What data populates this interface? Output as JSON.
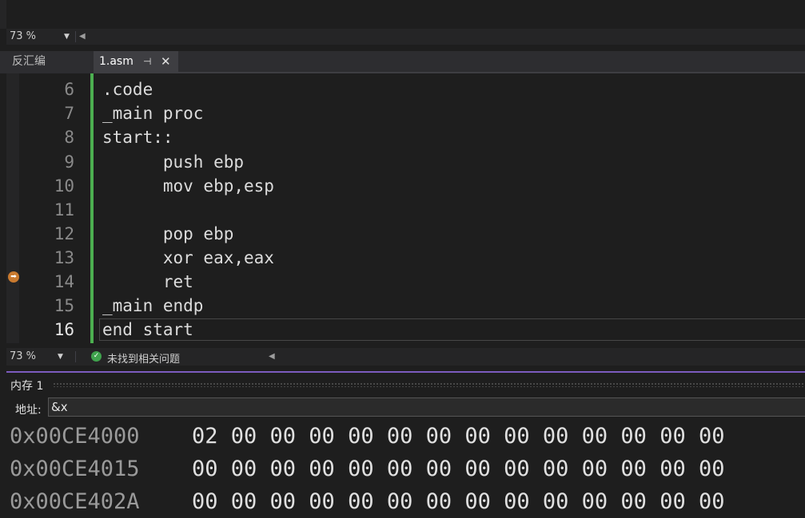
{
  "top_zoom": {
    "value": "73 %"
  },
  "tabs": [
    {
      "label": "反汇编"
    },
    {
      "label": "1.asm",
      "pin": "⊣",
      "close": "✕"
    }
  ],
  "editor": {
    "lines": [
      {
        "num": "6",
        "text": ".code"
      },
      {
        "num": "7",
        "text": "_main proc"
      },
      {
        "num": "8",
        "text": "start::"
      },
      {
        "num": "9",
        "text": "      push ebp"
      },
      {
        "num": "10",
        "text": "      mov ebp,esp"
      },
      {
        "num": "11",
        "text": ""
      },
      {
        "num": "12",
        "text": "      pop ebp"
      },
      {
        "num": "13",
        "text": "      xor eax,eax"
      },
      {
        "num": "14",
        "text": "      ret"
      },
      {
        "num": "15",
        "text": "_main endp"
      },
      {
        "num": "16",
        "text": "end start"
      }
    ],
    "current_line": "16"
  },
  "statusbar": {
    "zoom": "73 %",
    "issues": "未找到相关问题"
  },
  "memory": {
    "title": "内存 1",
    "address_label": "地址:",
    "address_value": "&x",
    "rows": [
      {
        "addr": "0x00CE4000",
        "bytes": "02 00 00 00 00 00 00 00 00 00 00 00 00 00"
      },
      {
        "addr": "0x00CE4015",
        "bytes": "00 00 00 00 00 00 00 00 00 00 00 00 00 00"
      },
      {
        "addr": "0x00CE402A",
        "bytes": "00 00 00 00 00 00 00 00 00 00 00 00 00 00"
      }
    ]
  }
}
